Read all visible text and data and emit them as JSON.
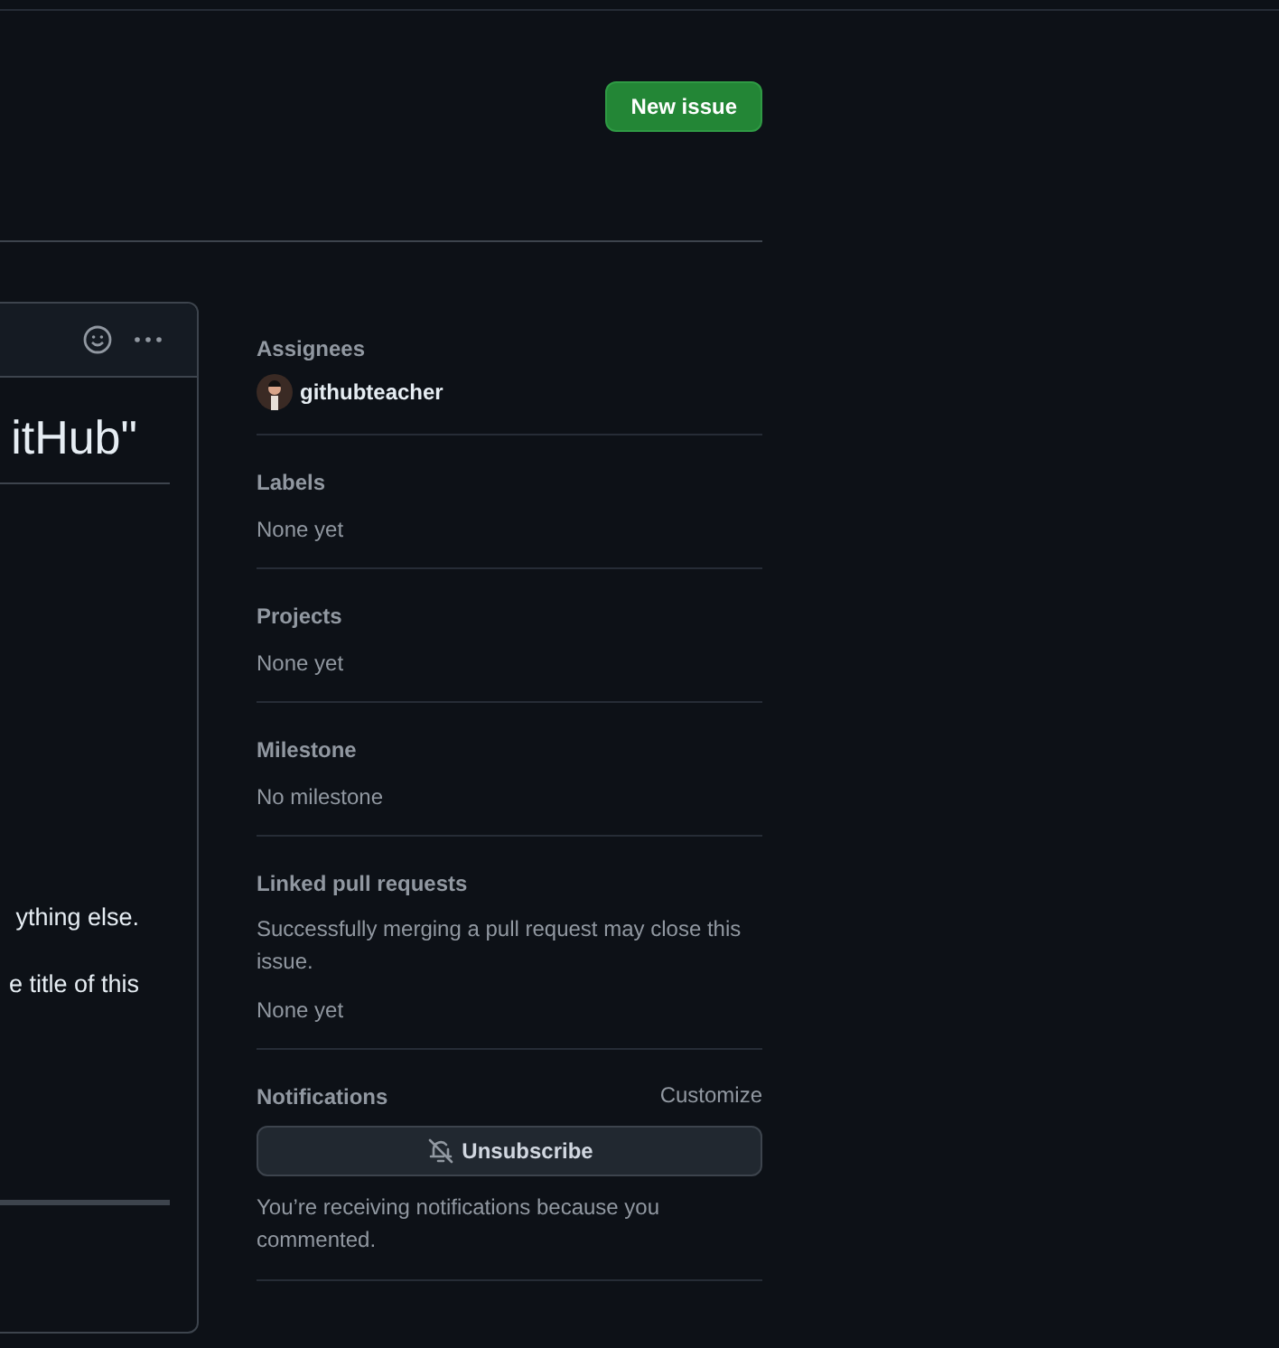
{
  "header": {
    "new_issue_button": "New issue"
  },
  "issue_card": {
    "title": "itHub\"",
    "body_lines": [
      "ything else.",
      "e title of this"
    ]
  },
  "sidebar": {
    "sections": [
      {
        "kind": "assignees",
        "heading": "Assignees",
        "people": [
          "githubteacher"
        ]
      },
      {
        "kind": "text",
        "heading": "Labels",
        "lines": [
          "None yet"
        ]
      },
      {
        "kind": "text",
        "heading": "Projects",
        "lines": [
          "None yet"
        ]
      },
      {
        "kind": "text",
        "heading": "Milestone",
        "lines": [
          "No milestone"
        ]
      },
      {
        "kind": "text",
        "heading": "Linked pull requests",
        "note": "Successfully merging a pull request may close this issue.",
        "lines": [
          "None yet"
        ]
      },
      {
        "kind": "notifications",
        "heading": "Notifications",
        "action": "Customize",
        "button": "Unsubscribe",
        "note": "You’re receiving notifications because you commented."
      }
    ]
  }
}
